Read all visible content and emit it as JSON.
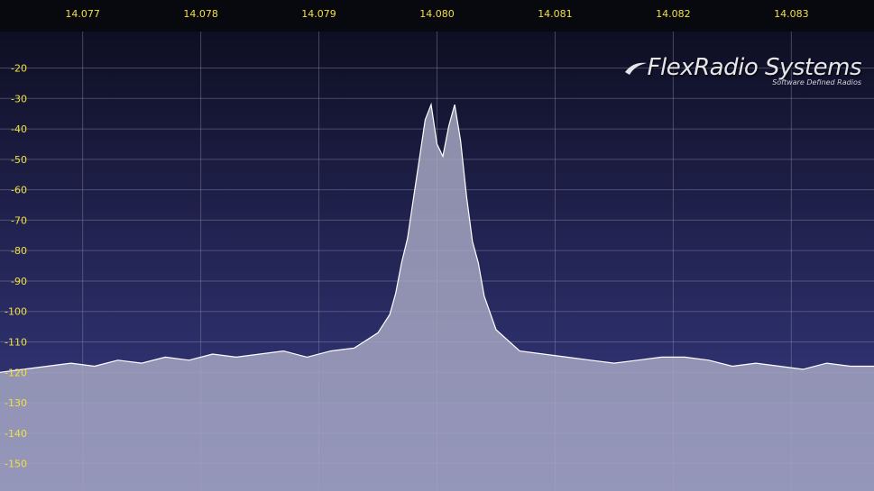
{
  "logo": {
    "name": "FlexRadio Systems",
    "tagline": "Software Defined Radios"
  },
  "colors": {
    "frequency_labels": "#f0e040",
    "db_labels": "#f0e040",
    "background_top": "#0b0b1c",
    "background_bottom": "#3a3d8a",
    "trace_line": "#ffffff",
    "trace_fill": "#a8a9c4",
    "grid": "#8a8aa8"
  },
  "chart_data": {
    "type": "area",
    "title": "",
    "xlabel": "",
    "ylabel": "",
    "x_ticks": [
      "14.077",
      "14.078",
      "14.079",
      "14.080",
      "14.081",
      "14.082",
      "14.083"
    ],
    "y_ticks": [
      "-20",
      "-30",
      "-40",
      "-50",
      "-60",
      "-70",
      "-80",
      "-90",
      "-100",
      "-110",
      "-120",
      "-130",
      "-140",
      "-150"
    ],
    "xlim": [
      14.0763,
      14.0837
    ],
    "ylim": [
      -159,
      -8
    ],
    "grid": true,
    "series": [
      {
        "x": [
          14.0763,
          14.0765,
          14.0767,
          14.0769,
          14.0771,
          14.0773,
          14.0775,
          14.0777,
          14.0779,
          14.0781,
          14.0783,
          14.0785,
          14.0787,
          14.0789,
          14.0791,
          14.0793,
          14.0795,
          14.0796,
          14.07965,
          14.0797,
          14.07975,
          14.0798,
          14.07985,
          14.0799,
          14.07995,
          14.08,
          14.08005,
          14.0801,
          14.08015,
          14.0802,
          14.08025,
          14.0803,
          14.08035,
          14.0804,
          14.0805,
          14.0807,
          14.0809,
          14.0811,
          14.0813,
          14.0815,
          14.0817,
          14.0819,
          14.0821,
          14.0823,
          14.0825,
          14.0827,
          14.0829,
          14.0831,
          14.0833,
          14.0835,
          14.0837
        ],
        "y": [
          -120,
          -119,
          -118,
          -117,
          -118,
          -116,
          -117,
          -115,
          -116,
          -114,
          -115,
          -114,
          -113,
          -115,
          -113,
          -112,
          -107,
          -101,
          -94,
          -84,
          -76,
          -63,
          -50,
          -37,
          -32,
          -45,
          -49,
          -39,
          -32,
          -44,
          -62,
          -77,
          -84,
          -95,
          -106,
          -113,
          -114,
          -115,
          -116,
          -117,
          -116,
          -115,
          -115,
          -116,
          -118,
          -117,
          -118,
          -119,
          -117,
          -118,
          -118
        ]
      }
    ]
  }
}
